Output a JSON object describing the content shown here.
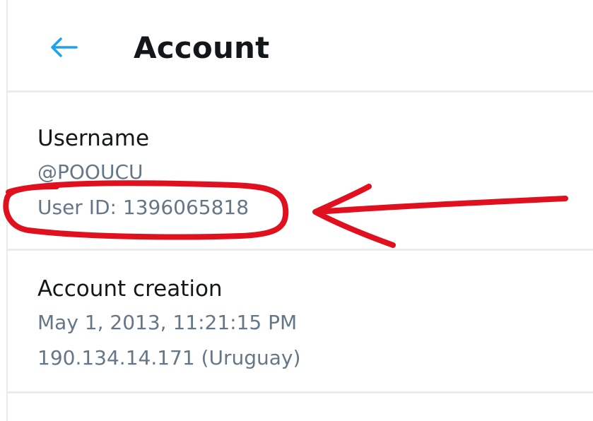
{
  "header": {
    "title": "Account",
    "back_icon": "arrow-left-icon"
  },
  "username_section": {
    "label": "Username",
    "handle": "@POOUCU",
    "user_id": "User ID: 1396065818"
  },
  "account_creation_section": {
    "label": "Account creation",
    "date": "May 1, 2013, 11:21:15 PM",
    "ip": "190.134.14.171 (Uruguay)"
  },
  "colors": {
    "accent": "#1da1f2",
    "text_primary": "#14171a",
    "text_secondary": "#657786",
    "divider": "#e6ecf0",
    "annotation": "#e0101e"
  }
}
